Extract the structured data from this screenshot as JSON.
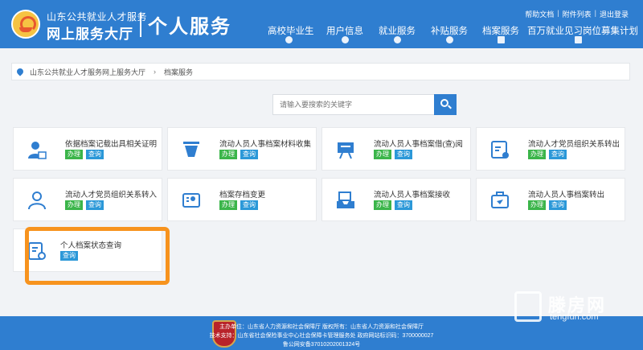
{
  "header": {
    "org_small": "山东公共就业人才服务",
    "org_big": "网上服务大厅",
    "section_title": "个人服务",
    "top_links": [
      "帮助文档",
      "附件列表",
      "退出登录"
    ],
    "nav": [
      {
        "label": "高校毕业生",
        "icon": "graduate-icon"
      },
      {
        "label": "用户信息",
        "icon": "user-info-icon"
      },
      {
        "label": "就业服务",
        "icon": "job-icon"
      },
      {
        "label": "补贴服务",
        "icon": "subsidy-icon"
      },
      {
        "label": "档案服务",
        "icon": "archive-icon"
      },
      {
        "label": "百万就业见习岗位募集计划",
        "icon": "internship-icon"
      }
    ]
  },
  "breadcrumb": {
    "home": "山东公共就业人才服务网上服务大厅",
    "separator": "›",
    "current": "档案服务"
  },
  "search": {
    "placeholder": "请输入要搜索的关键字",
    "value": ""
  },
  "badges": {
    "apply": "办理",
    "query": "查询"
  },
  "cards": [
    {
      "title": "依据档案记载出具相关证明",
      "icon": "person-certificate-icon",
      "badges": [
        "办理",
        "查询"
      ]
    },
    {
      "title": "流动人员人事档案材料收集",
      "icon": "funnel-collect-icon",
      "badges": [
        "办理",
        "查询"
      ]
    },
    {
      "title": "流动人员人事档案借(查)阅",
      "icon": "presentation-board-icon",
      "badges": [
        "办理",
        "查询"
      ]
    },
    {
      "title": "流动人才党员组织关系转出",
      "icon": "document-transfer-out-icon",
      "badges": [
        "办理",
        "查询"
      ]
    },
    {
      "title": "流动人才党员组织关系转入",
      "icon": "person-transfer-in-icon",
      "badges": [
        "办理",
        "查询"
      ]
    },
    {
      "title": "档案存档变更",
      "icon": "id-card-icon",
      "badges": [
        "办理",
        "查询"
      ]
    },
    {
      "title": "流动人员人事档案接收",
      "icon": "archive-receive-icon",
      "badges": [
        "办理",
        "查询"
      ]
    },
    {
      "title": "流动人员人事档案转出",
      "icon": "briefcase-send-icon",
      "badges": [
        "办理",
        "查询"
      ]
    },
    {
      "title": "个人档案状态查询",
      "icon": "document-status-icon",
      "badges": [
        "查询"
      ]
    }
  ],
  "footer": {
    "line1": "主办单位：山东省人力资源和社会保障厅 版权所有：山东省人力资源和社会保障厅",
    "line2": "技术支持：山东省社会保险事业中心社会保障卡管理服务处 政府网站标识码：3700000027",
    "line3": "鲁公网安备37010202001324号",
    "shield_text": "政府网站"
  },
  "watermark": {
    "title": "滕房网",
    "url": "tengfun.com"
  },
  "colors": {
    "primary": "#2f7ed0",
    "green": "#3bb54a",
    "blue_badge": "#2b98d8",
    "highlight": "#f7931e"
  }
}
